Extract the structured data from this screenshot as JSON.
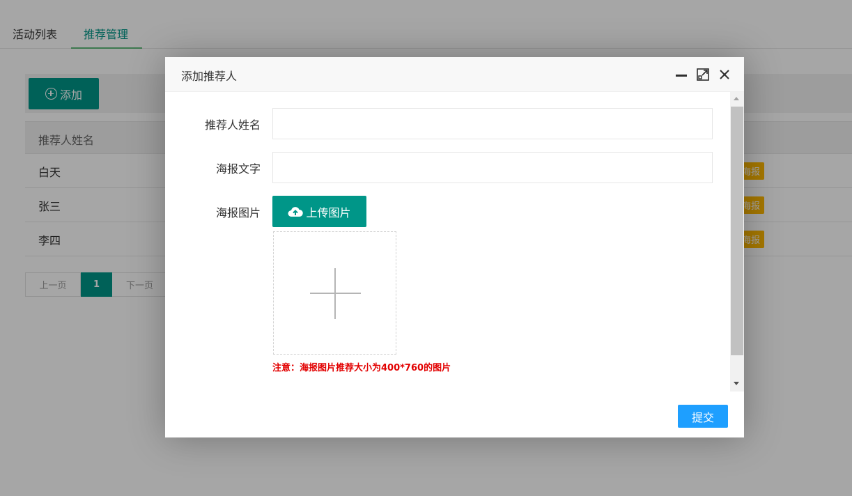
{
  "tabs": [
    {
      "label": "活动列表"
    },
    {
      "label": "推荐管理",
      "active": true
    }
  ],
  "toolbar": {
    "add_label": "添加"
  },
  "table": {
    "header": "推荐人姓名",
    "rows": [
      {
        "name": "白天",
        "action": "海报"
      },
      {
        "name": "张三",
        "action": "海报"
      },
      {
        "name": "李四",
        "action": "海报"
      }
    ]
  },
  "pager": {
    "prev": "上一页",
    "current": "1",
    "next": "下一页"
  },
  "modal": {
    "title": "添加推荐人",
    "fields": {
      "name_label": "推荐人姓名",
      "name_value": "",
      "text_label": "海报文字",
      "text_value": "",
      "image_label": "海报图片"
    },
    "upload_label": "上传图片",
    "note": "注意：海报图片推荐大小为400*760的图片",
    "submit_label": "提交"
  },
  "colors": {
    "primary": "#009688",
    "submit": "#1e9fff",
    "warning": "#ffb800",
    "note": "#e20000"
  },
  "icons": [
    "plus-circle-icon",
    "minimize-icon",
    "maximize-icon",
    "close-icon",
    "cloud-upload-icon",
    "plus-icon"
  ]
}
